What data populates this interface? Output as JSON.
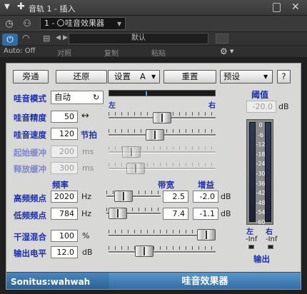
{
  "host": {
    "title": "音轨 1 - 插入",
    "slot_label": "1 - ",
    "plugin_name": "哇音效果器",
    "preset_name": "默认",
    "auto_mode": "Auto: Off",
    "toolbar": {
      "compare": "对照",
      "copy": "复制",
      "paste": "粘贴"
    }
  },
  "plugin": {
    "top_buttons": {
      "bypass": "旁通",
      "restore": "还原",
      "settings": "设置",
      "settings_slot": "A",
      "reset": "重置",
      "presets": "预设",
      "help": "?"
    },
    "wah_mode": {
      "label": "哇音模式",
      "value": "自动",
      "slider_left": "左",
      "slider_right": "右"
    },
    "params": {
      "precision": {
        "label": "哇音精度",
        "value": "50",
        "unit": "↔"
      },
      "speed": {
        "label": "哇音速度",
        "value": "120",
        "unit": "节拍"
      },
      "attack": {
        "label": "起始缓冲",
        "value": "200",
        "unit": "ms"
      },
      "release": {
        "label": "释放缓冲",
        "value": "300",
        "unit": "ms"
      },
      "freq_header": "频率",
      "bandwidth_header": "带宽",
      "gain_header": "增益",
      "high_freq": {
        "label": "高频频点",
        "value": "2020",
        "unit": "Hz",
        "bandwidth": "2.5",
        "gain": "-2.0",
        "gain_unit": "dB"
      },
      "low_freq": {
        "label": "低频频点",
        "value": "784",
        "unit": "Hz",
        "bandwidth": "7.4",
        "gain": "-1.1",
        "gain_unit": "dB"
      },
      "drywet": {
        "label": "干湿混合",
        "value": "100",
        "unit": "%"
      },
      "output": {
        "label": "输出电平",
        "value": "12.0",
        "unit": "dB"
      }
    },
    "slider_levels": {
      "precision": 0.5,
      "speed": 0.42,
      "attack": 0.15,
      "release": 0.2,
      "high_freq": 0.22,
      "low_freq": 0.06,
      "drywet": 1.0,
      "output": 0.3,
      "wah_indicator": 0.35
    },
    "threshold": {
      "label": "阈值",
      "value": "-20.0",
      "unit": "dB"
    },
    "meter": {
      "scale": [
        "0",
        "-6",
        "-12",
        "-18",
        "-24",
        "-30",
        "-36",
        "-42",
        "-48",
        "-54",
        "-60"
      ],
      "left_label": "左",
      "right_label": "右",
      "left_peak": "-Inf",
      "right_peak": "-Inf",
      "output_label": "输出"
    },
    "footer": {
      "brand": "Sonitus:wahwah",
      "name": "哇音效果器"
    }
  },
  "colors": {
    "accent_blue": "#1c2fb0",
    "footer_blue": "#2e6aa3",
    "power_blue": "#2d6ea8"
  }
}
